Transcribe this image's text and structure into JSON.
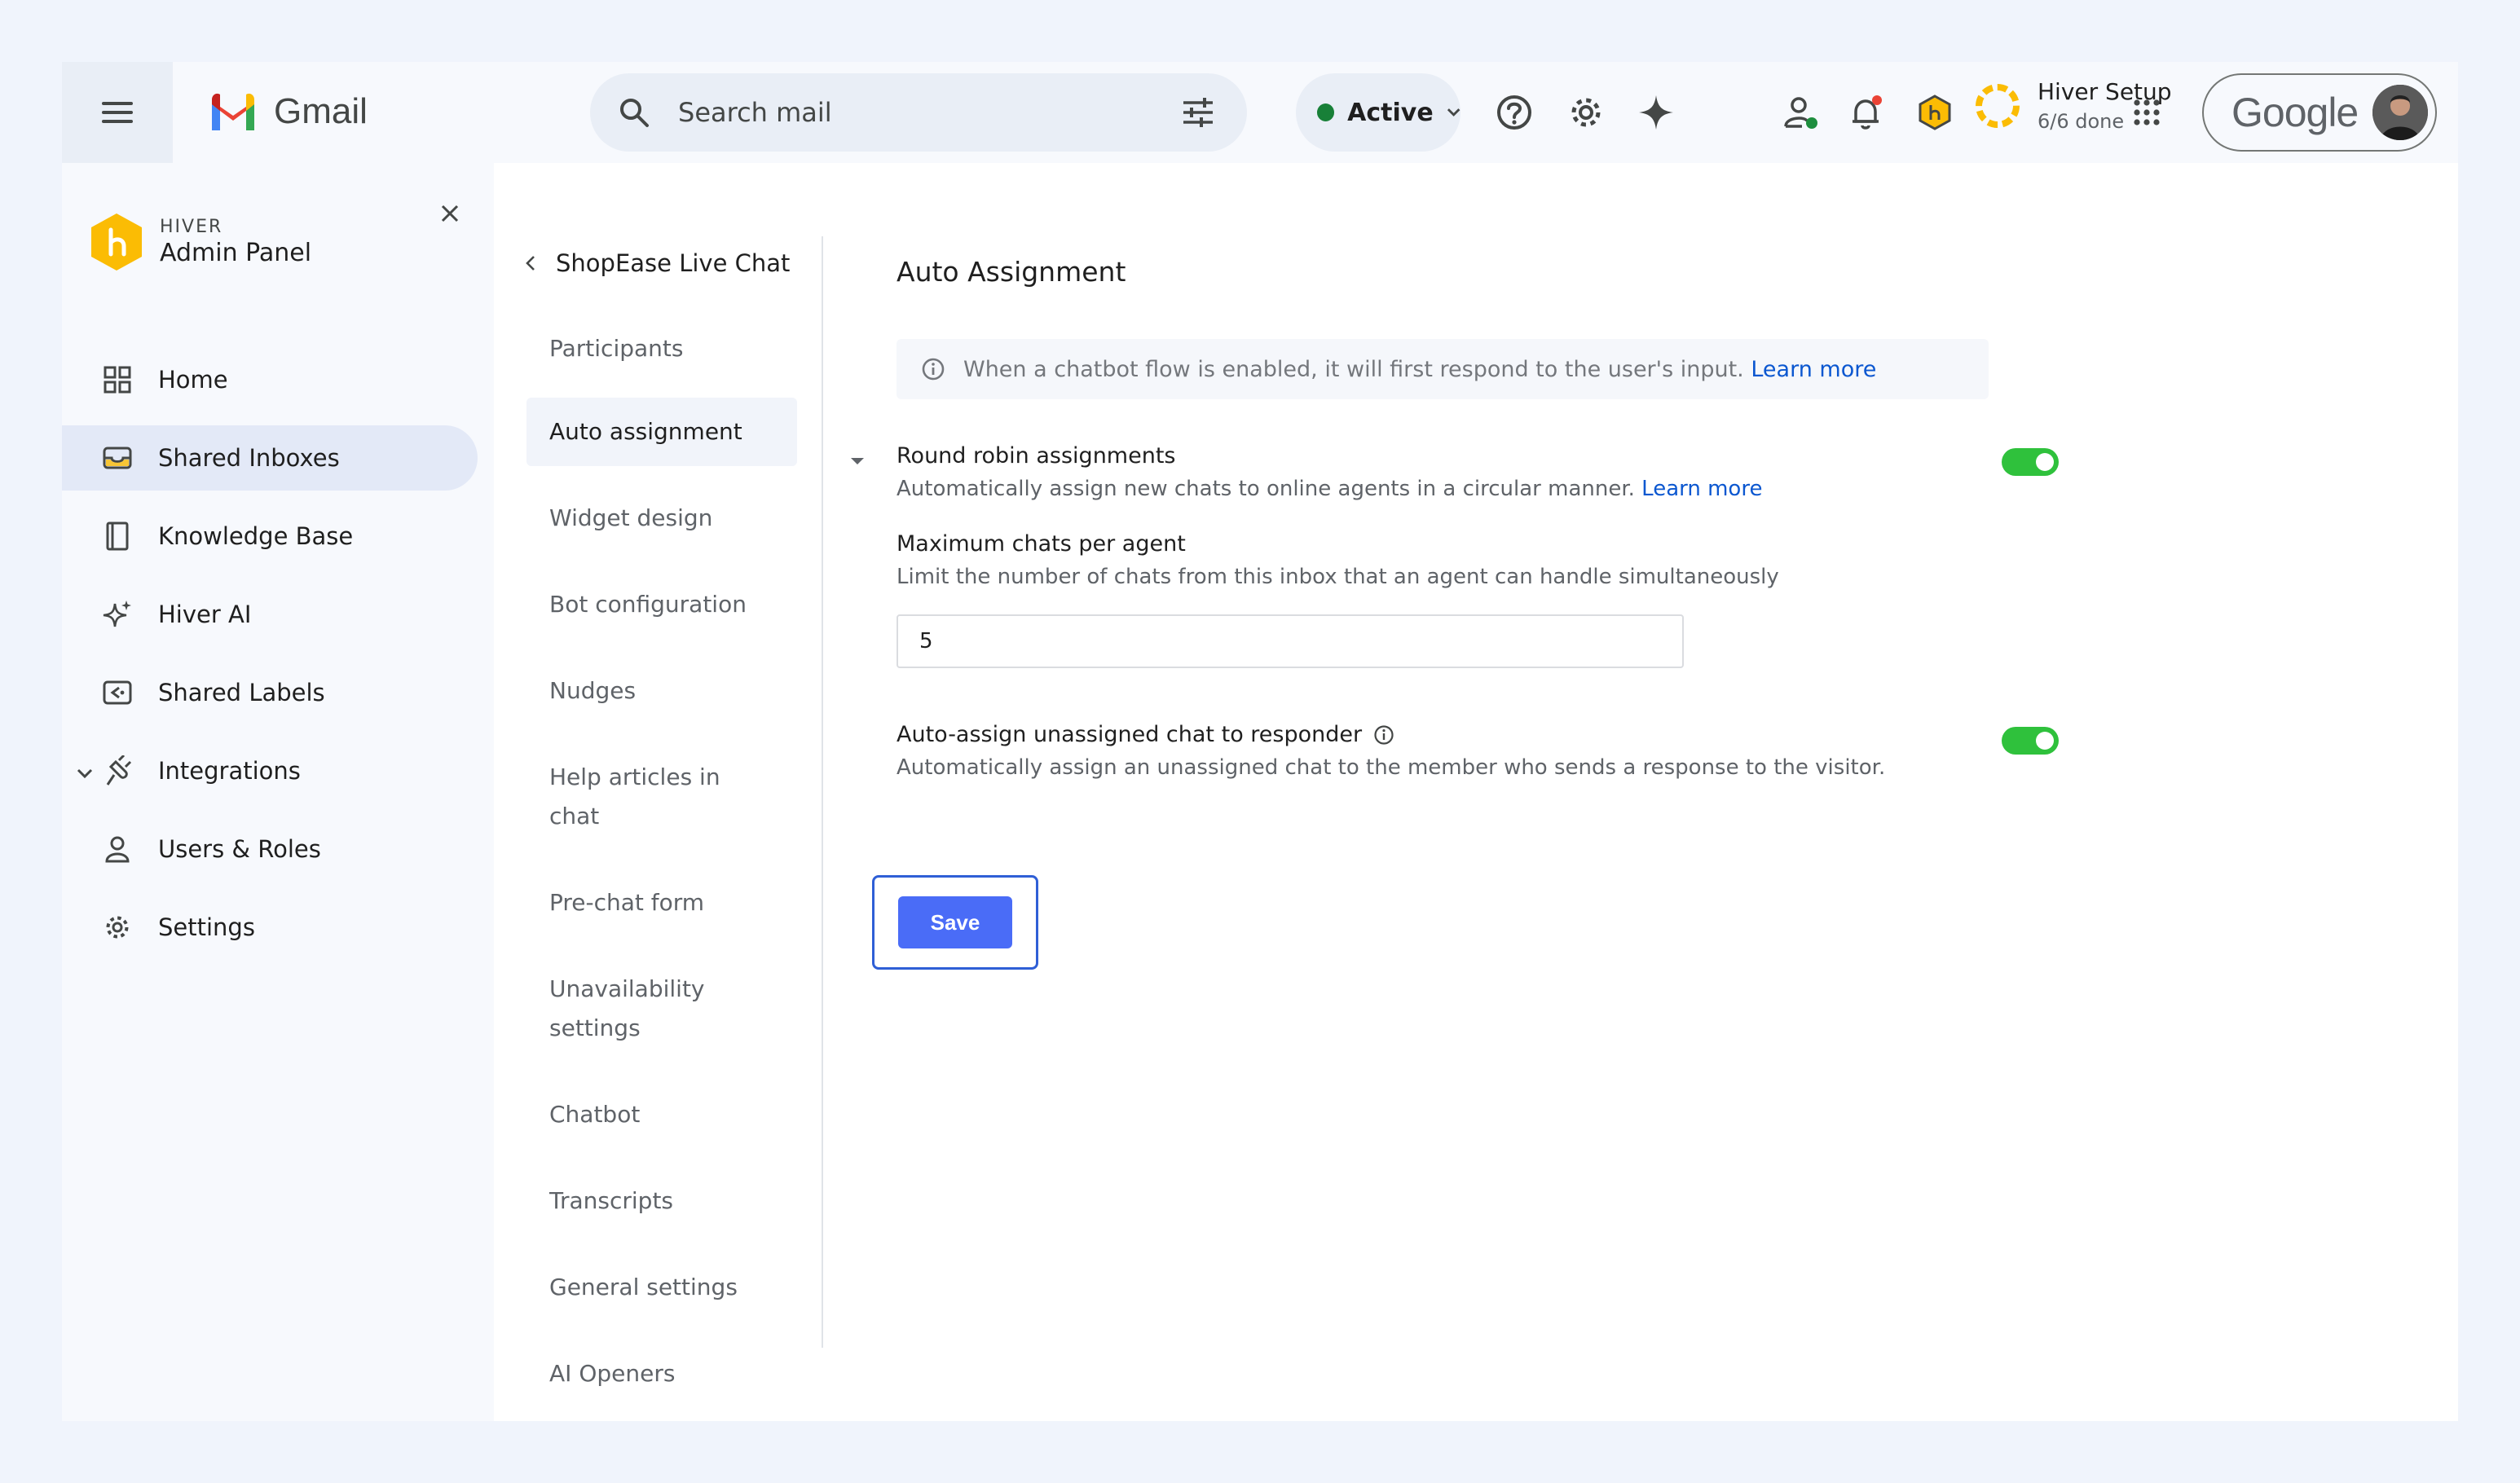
{
  "topbar": {
    "app_name": "Gmail",
    "search_placeholder": "Search mail",
    "status_label": "Active",
    "setup_title": "Hiver Setup",
    "setup_progress": "6/6 done",
    "google_label": "Google"
  },
  "sidebar": {
    "brand_small": "HIVER",
    "brand_big": "Admin Panel",
    "items": [
      {
        "label": "Home",
        "icon": "grid-icon"
      },
      {
        "label": "Shared Inboxes",
        "icon": "inbox-icon",
        "selected": true
      },
      {
        "label": "Knowledge Base",
        "icon": "book-icon"
      },
      {
        "label": "Hiver AI",
        "icon": "sparkle-icon"
      },
      {
        "label": "Shared Labels",
        "icon": "label-icon"
      },
      {
        "label": "Integrations",
        "icon": "plug-icon"
      },
      {
        "label": "Users & Roles",
        "icon": "user-icon"
      },
      {
        "label": "Settings",
        "icon": "gear-icon"
      }
    ]
  },
  "subnav": {
    "header": "ShopEase Live Chat",
    "items": [
      "Participants",
      "Auto assignment",
      "Widget design",
      "Bot configuration",
      "Nudges",
      "Help articles in chat",
      "Pre-chat form",
      "Unavailability settings",
      "Chatbot",
      "Transcripts",
      "General settings",
      "AI Openers"
    ]
  },
  "main": {
    "title": "Auto Assignment",
    "info_text": "When a chatbot flow is enabled, it will first respond to the user's input.",
    "info_link": "Learn more",
    "round_robin": {
      "title": "Round robin assignments",
      "desc": "Automatically assign new chats to online agents in a circular manner.",
      "link": "Learn more",
      "enabled": true
    },
    "max_chats": {
      "title": "Maximum chats per agent",
      "desc": "Limit the number of chats from this inbox that an agent can handle simultaneously",
      "value": "5"
    },
    "auto_assign": {
      "title": "Auto-assign unassigned chat to responder",
      "desc": "Automatically assign an unassigned chat to the member who sends a response to the visitor.",
      "enabled": true
    },
    "save_label": "Save"
  },
  "colors": {
    "accent": "#4a6cf7",
    "toggle_on": "#2fc13c",
    "link": "#0b57d0",
    "selected_bg": "#e3e9f7"
  }
}
